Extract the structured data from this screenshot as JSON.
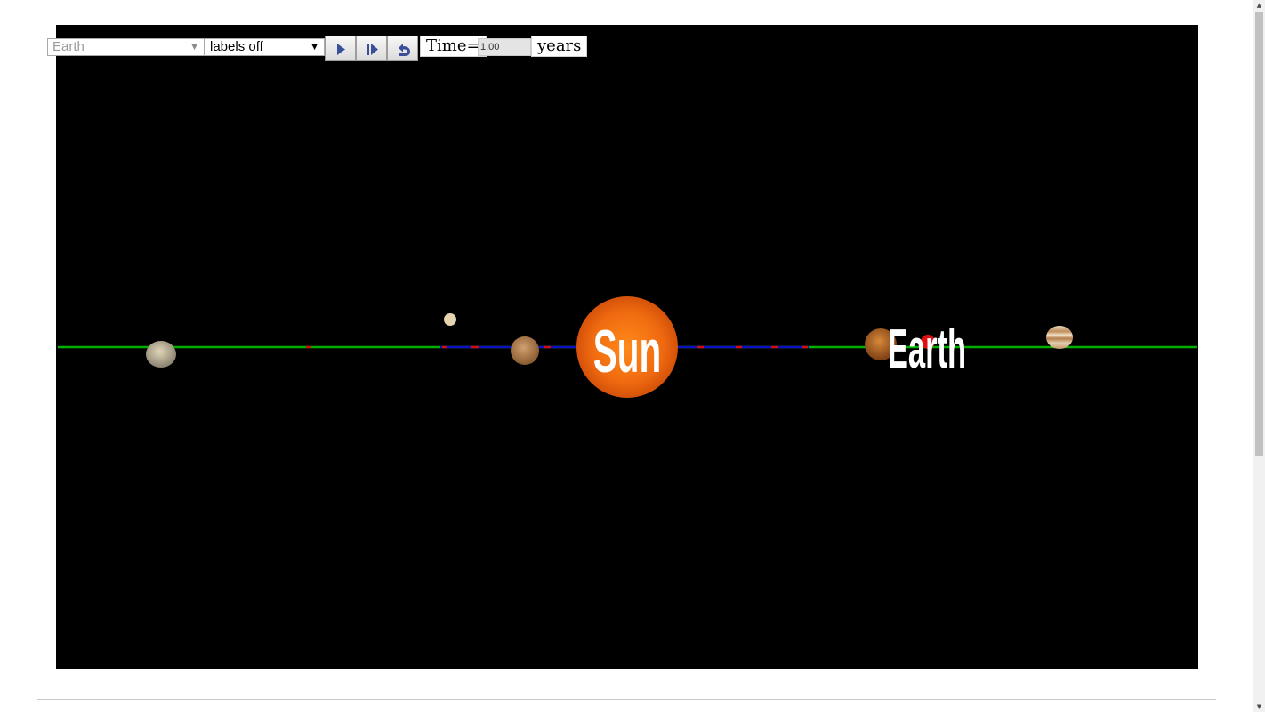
{
  "controls": {
    "body_select": "Earth",
    "labels_select": "labels off",
    "play_button": "play-icon",
    "step_button": "step-forward-icon",
    "reset_button": "undo-icon",
    "time_label": "Time=",
    "time_value": "1.00",
    "time_unit": "years"
  },
  "scene": {
    "background": "#000000",
    "ecliptic_color": "#00b000",
    "orbit_color": "#1010c0",
    "labels": {
      "sun": "Sun",
      "earth": "Earth"
    }
  }
}
